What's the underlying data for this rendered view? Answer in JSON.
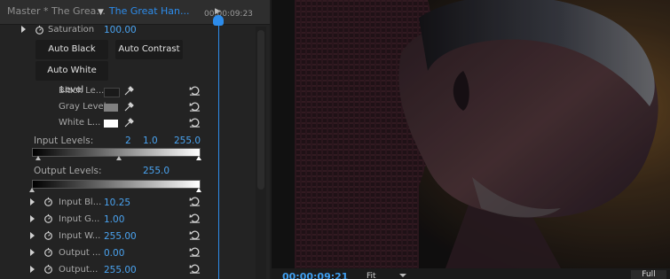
{
  "tabs": {
    "master": "Master * The Grea...",
    "sequence": "The Great Han...",
    "next": "▶"
  },
  "timeline_timecode": "00:00:09:23",
  "params": {
    "saturation_label": "Saturation",
    "saturation_value": "100.00",
    "auto_black_level": "Auto Black Level",
    "auto_contrast": "Auto Contrast",
    "auto_white_level": "Auto White Level",
    "black_level_label": "Black Le...",
    "gray_level_label": "Gray Level",
    "white_level_label": "White L...",
    "black_level_color": "#1a1a1a",
    "gray_level_color": "#808080",
    "white_level_color": "#ffffff",
    "input_levels_label": "Input Levels:",
    "input_levels_black": "2",
    "input_levels_gamma": "1.0",
    "input_levels_white": "255.0",
    "output_levels_label": "Output Levels:",
    "output_levels_value": "255.0",
    "rows": [
      {
        "label": "Input Bl...",
        "value": "10.25"
      },
      {
        "label": "Input G...",
        "value": "1.00"
      },
      {
        "label": "Input W...",
        "value": "255.00"
      },
      {
        "label": "Output ...",
        "value": "0.00"
      },
      {
        "label": "Output...",
        "value": "255.00"
      }
    ]
  },
  "monitor": {
    "timecode": "00:00:09:21",
    "zoom": "Fit",
    "resolution": "Full"
  },
  "colors": {
    "accent": "#2d8ceb",
    "value_blue": "#4aa3f0"
  }
}
